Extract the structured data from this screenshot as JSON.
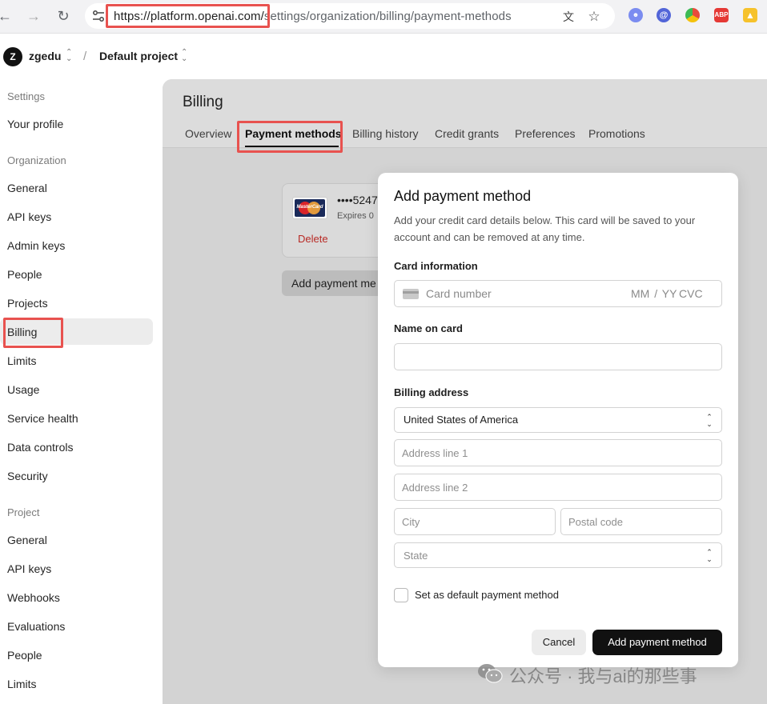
{
  "browser": {
    "url_host": "https://platform.openai.com/",
    "url_path": "settings/organization/billing/payment-methods",
    "colors": {
      "highlight": "#e8524f"
    },
    "extensions": [
      "ai-face-icon",
      "at-sign-icon",
      "chrome-color-icon",
      "adblock-icon",
      "yellow-bulb-icon"
    ],
    "ext_labels": {
      "adblock": "ABP"
    }
  },
  "topbar": {
    "org_initial": "Z",
    "org_name": "zgedu",
    "separator": "/",
    "project_name": "Default project"
  },
  "sidebar": {
    "section_settings": "Settings",
    "your_profile": "Your profile",
    "section_org": "Organization",
    "org_items": [
      "General",
      "API keys",
      "Admin keys",
      "People",
      "Projects",
      "Billing",
      "Limits",
      "Usage",
      "Service health",
      "Data controls",
      "Security"
    ],
    "section_project": "Project",
    "project_items": [
      "General",
      "API keys",
      "Webhooks",
      "Evaluations",
      "People",
      "Limits"
    ],
    "active_item": "Billing"
  },
  "main": {
    "title": "Billing",
    "tabs": [
      "Overview",
      "Payment methods",
      "Billing history",
      "Credit grants",
      "Preferences",
      "Promotions"
    ],
    "active_tab": "Payment methods",
    "card": {
      "brand": "MasterCard",
      "number": "••••5247",
      "expiry": "Expires 0",
      "delete_label": "Delete"
    },
    "add_button_label": "Add payment me"
  },
  "modal": {
    "title": "Add payment method",
    "description": "Add your credit card details below. This card will be saved to your account and can be removed at any time.",
    "card_info_label": "Card information",
    "card_number_placeholder": "Card number",
    "expiry_placeholder": "MM / YY",
    "cvc_placeholder": "CVC",
    "name_label": "Name on card",
    "name_value": "",
    "billing_label": "Billing address",
    "country_value": "United States of America",
    "address1_placeholder": "Address line 1",
    "address2_placeholder": "Address line 2",
    "city_placeholder": "City",
    "postal_placeholder": "Postal code",
    "state_placeholder": "State",
    "default_checkbox_label": "Set as default payment method",
    "default_checked": false,
    "cancel_label": "Cancel",
    "submit_label": "Add payment method"
  },
  "watermark": {
    "text": "公众号 · 我与ai的那些事"
  }
}
